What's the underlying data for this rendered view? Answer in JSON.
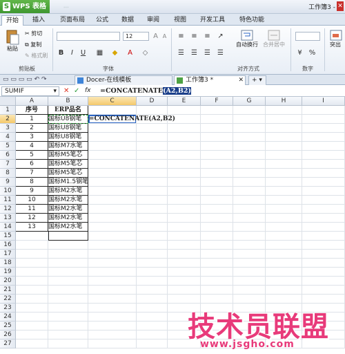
{
  "window": {
    "app_name": "WPS 表格",
    "title_blurred": "...",
    "doc_title": "工作簿3 -"
  },
  "menu_tabs": [
    "开始",
    "插入",
    "页面布局",
    "公式",
    "数据",
    "审阅",
    "视图",
    "开发工具",
    "特色功能"
  ],
  "ribbon": {
    "clipboard": {
      "paste": "粘贴",
      "cut": "剪切",
      "copy": "复制",
      "format_painter": "格式刷",
      "group": "剪贴板"
    },
    "font": {
      "size": "12",
      "group": "字体",
      "bold": "B",
      "italic": "I",
      "underline": "U",
      "a_plus": "A",
      "a_minus": "A"
    },
    "align": {
      "group": "对齐方式",
      "wrap": "自动换行",
      "merge": "合并居中"
    },
    "number": {
      "group": "数字"
    },
    "extra": {
      "label": "突出"
    }
  },
  "doc_tabs": [
    {
      "label": "Docer-在线模板"
    },
    {
      "label": "工作簿3 *"
    }
  ],
  "formula_bar": {
    "name_box": "SUMIF",
    "cancel": "✕",
    "confirm": "✓",
    "fx": "fx",
    "formula_prefix": "=CONCATENATE",
    "formula_args": "(A2,B2)"
  },
  "columns": [
    "A",
    "B",
    "C",
    "D",
    "E",
    "F",
    "G",
    "H",
    "I"
  ],
  "rows": [
    "1",
    "2",
    "3",
    "4",
    "5",
    "6",
    "7",
    "8",
    "9",
    "10",
    "11",
    "12",
    "13",
    "14",
    "15",
    "16",
    "17",
    "18",
    "19",
    "20",
    "21",
    "22",
    "23",
    "24",
    "25",
    "26",
    "27"
  ],
  "table": {
    "headers": [
      "序号",
      "ERP品名"
    ],
    "data": [
      [
        "1",
        "国标U8钢笔"
      ],
      [
        "2",
        "国标U8钢笔"
      ],
      [
        "3",
        "国标U8钢笔"
      ],
      [
        "4",
        "国标M7水笔"
      ],
      [
        "5",
        "国标M5笔芯"
      ],
      [
        "6",
        "国标M5笔芯"
      ],
      [
        "7",
        "国标M5笔芯"
      ],
      [
        "8",
        "国标M1.5钢笔"
      ],
      [
        "9",
        "国标M2水笔"
      ],
      [
        "10",
        "国标M2水笔"
      ],
      [
        "11",
        "国标M2水笔"
      ],
      [
        "12",
        "国标M2水笔"
      ],
      [
        "13",
        "国标M2水笔"
      ]
    ],
    "c2_edit": "=CONCATENATE(A2,B2)"
  },
  "watermark": {
    "main": "技术员联盟",
    "sub": "www.jsgho.com"
  }
}
